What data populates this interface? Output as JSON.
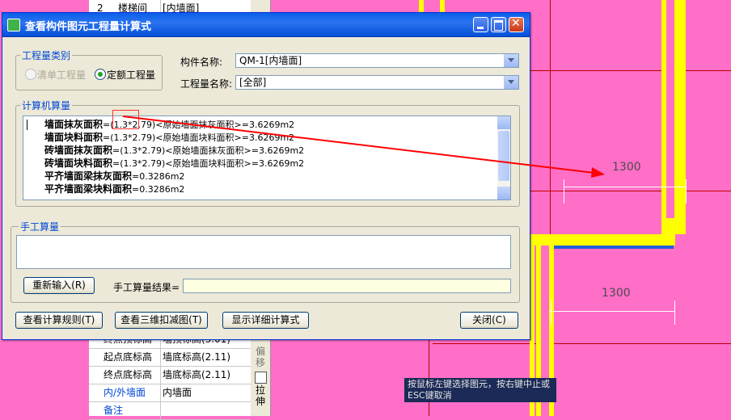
{
  "dialog": {
    "title": "查看构件图元工程量计算式",
    "quantity_type_group": "工程量类别",
    "radio_bill": "清单工程量",
    "radio_quota": "定额工程量",
    "component_name_label": "构件名称:",
    "component_name_value": "QM-1[内墙面]",
    "quantity_name_label": "工程量名称:",
    "quantity_name_value": "[全部]",
    "computer_calc_group": "计算机算量",
    "calc_lines": [
      {
        "name": "墙面抹灰面积",
        "formula": "=(1.3*2.79)<原始墙面抹灰面积>=3.6269m2"
      },
      {
        "name": "墙面块料面积",
        "formula": "=(1.3*2.79)<原始墙面块料面积>=3.6269m2"
      },
      {
        "name": "砖墙面抹灰面积",
        "formula": "=(1.3*2.79)<原始墙面抹灰面积>=3.6269m2"
      },
      {
        "name": "砖墙面块料面积",
        "formula": "=(1.3*2.79)<原始墙面块料面积>=3.6269m2"
      },
      {
        "name": "平齐墙面梁抹灰面积",
        "formula": "=0.3286m2"
      },
      {
        "name": "平齐墙面梁块料面积",
        "formula": "=0.3286m2"
      }
    ],
    "manual_calc_group": "手工算量",
    "reenter_button": "重新输入(R)",
    "manual_result_label": "手工算量结果=",
    "view_rules_button": "查看计算规则(T)",
    "view_3d_button": "查看三维扣减图(T)",
    "show_detail_button": "显示详细计算式",
    "close_button": "关闭(C)"
  },
  "property_panel": {
    "rows": [
      {
        "num": "2",
        "name": "楼梯间",
        "value": "[内墙面]"
      },
      {
        "name": "终点顶标高",
        "value": "墙顶标高(3.01)"
      },
      {
        "name": "起点底标高",
        "value": "墙底标高(2.11)"
      },
      {
        "name": "终点底标高",
        "value": "墙底标高(2.11)"
      },
      {
        "name": "内/外墙面",
        "value": "内墙面"
      },
      {
        "name": "备注",
        "value": ""
      }
    ]
  },
  "side_toolbar": {
    "offset_label": "偏移",
    "stretch_label": "拉伸"
  },
  "canvas": {
    "dim_top": "1300",
    "dim_bottom": "1300",
    "status_tip": "按鼠标左键选择图元，按右键中止或ESC键取消"
  },
  "colors": {
    "canvas_bg": "#ff6ec7",
    "wall_yellow": "#ffff00",
    "title_blue": "#0a5fe8",
    "arrow_red": "#ff0000",
    "group_label_blue": "#0046d5"
  }
}
